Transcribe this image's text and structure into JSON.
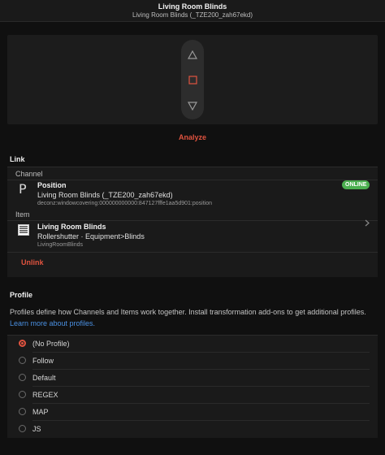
{
  "header": {
    "title": "Living Room Blinds",
    "subtitle": "Living Room Blinds (_TZE200_zah67ekd)"
  },
  "controls": {
    "up_icon": "triangle-up-icon",
    "stop_icon": "square-stop-icon",
    "down_icon": "triangle-down-icon"
  },
  "analyze_label": "Analyze",
  "link": {
    "title": "Link",
    "channel": {
      "group_label": "Channel",
      "icon": "P",
      "title": "Position",
      "name": "Living Room Blinds (_TZE200_zah67ekd)",
      "uid": "deconz:windowcovering:000000000000:847127fffe1aa5d901:position",
      "status": "ONLINE"
    },
    "item": {
      "group_label": "Item",
      "icon": "rollershutter-icon",
      "title": "Living Room Blinds",
      "type": "Rollershutter · Equipment>Blinds",
      "name": "LivingRoomBlinds"
    },
    "unlink_label": "Unlink"
  },
  "profile": {
    "title": "Profile",
    "description": "Profiles define how Channels and Items work together. Install transformation add-ons to get additional profiles.",
    "learn_more": "Learn more about profiles.",
    "selected": "(No Profile)",
    "options": [
      "(No Profile)",
      "Follow",
      "Default",
      "REGEX",
      "MAP",
      "JS"
    ]
  },
  "colors": {
    "accent": "#e0533f",
    "online": "#4caf50",
    "link": "#4a90e2",
    "background": "#101010"
  }
}
